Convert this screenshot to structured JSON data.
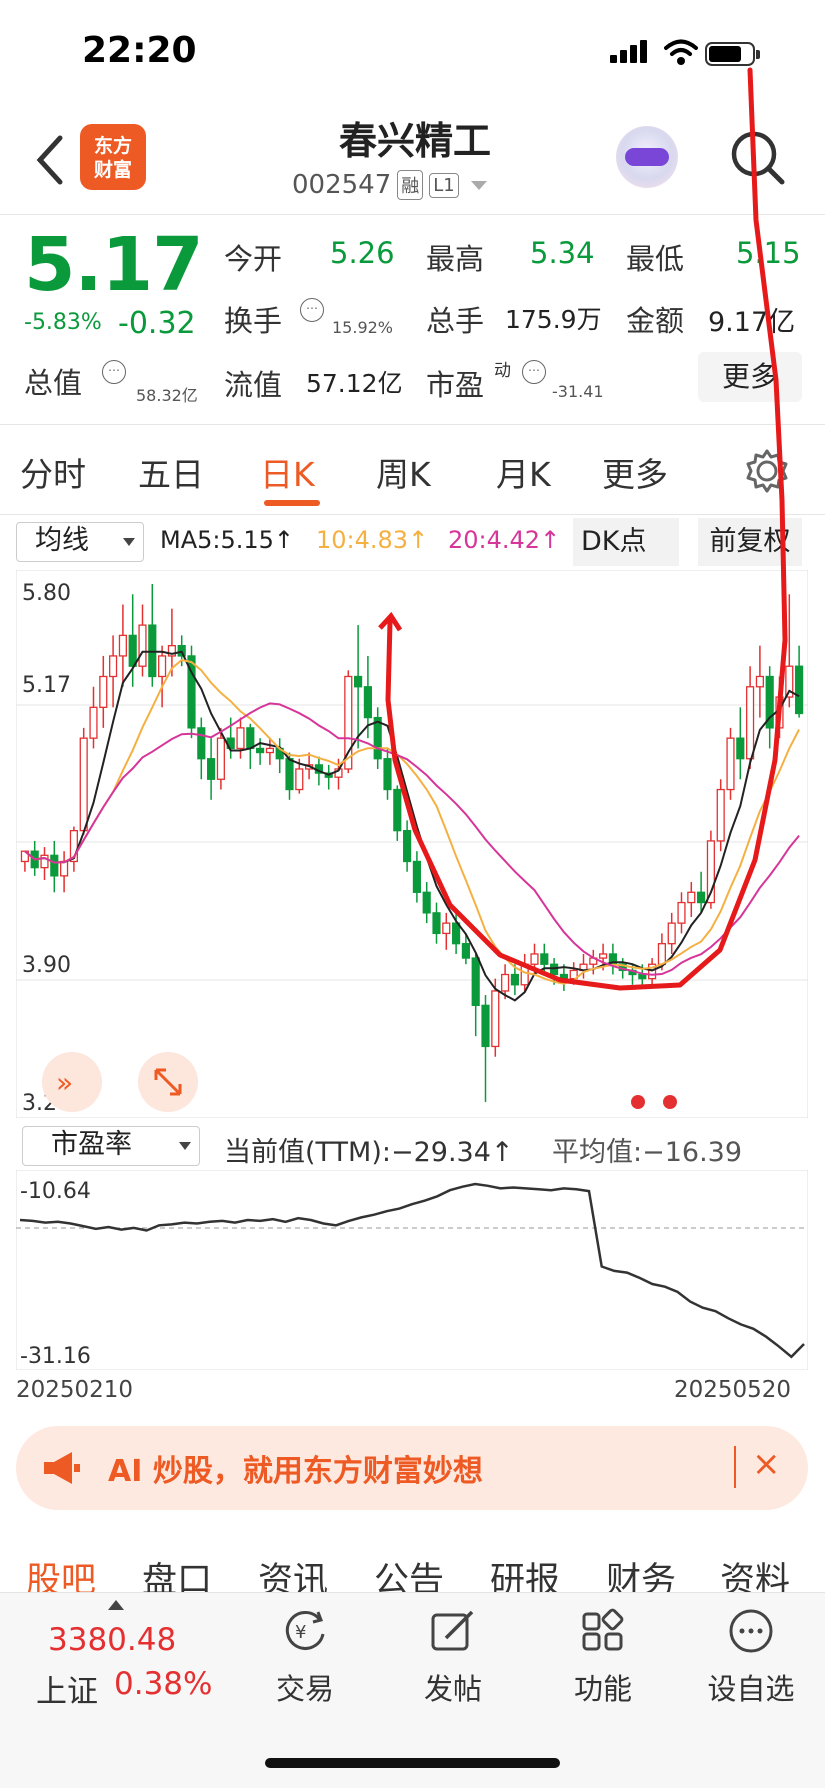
{
  "status": {
    "time": "22:20"
  },
  "header": {
    "logo_line1": "东方",
    "logo_line2": "财富",
    "title": "春兴精工",
    "code": "002547",
    "tag1": "融",
    "tag2": "L1"
  },
  "quote": {
    "price": "5.17",
    "change_pct": "-5.83%",
    "change": "-0.32",
    "open_label": "今开",
    "open": "5.26",
    "high_label": "最高",
    "high": "5.34",
    "low_label": "最低",
    "low": "5.15",
    "turnover_label": "换手",
    "turnover": "15.92%",
    "volume_label": "总手",
    "volume": "175.9万",
    "amount_label": "金额",
    "amount": "9.17亿",
    "mktcap_label": "总值",
    "mktcap": "58.32亿",
    "float_label": "流值",
    "float": "57.12亿",
    "pe_label": "市盈",
    "pe_sup": "动",
    "pe": "-31.41",
    "more": "更多"
  },
  "ktabs": [
    "分时",
    "五日",
    "日K",
    "周K",
    "月K",
    "更多"
  ],
  "indicator": {
    "select": "均线",
    "ma5": "MA5:5.15↑",
    "ma10": "10:4.83↑",
    "ma20": "20:4.42↑",
    "dk": "DK点",
    "fq": "前复权"
  },
  "colors": {
    "accent": "#ee5a24",
    "down": "#0a9a3c",
    "up": "#e43030",
    "ma10": "#f5b042",
    "ma20": "#d6359a"
  },
  "chart_data": {
    "type": "candlestick",
    "y_ticks": [
      "5.80",
      "5.17",
      "3.90",
      "3.27"
    ],
    "y_range": [
      3.27,
      5.8
    ],
    "markers": [
      "1",
      "2",
      "3",
      "4",
      "5",
      "6",
      "7",
      "8",
      "9",
      "1",
      "2",
      "3",
      "4",
      "5",
      "6",
      "8",
      "9",
      "1",
      "2",
      "3",
      "4",
      "5",
      "6",
      "7",
      "8",
      "9"
    ],
    "candles": [
      [
        4.45,
        4.5,
        4.4,
        4.5
      ],
      [
        4.5,
        4.42,
        4.38,
        4.55
      ],
      [
        4.42,
        4.48,
        4.36,
        4.52
      ],
      [
        4.48,
        4.38,
        4.3,
        4.55
      ],
      [
        4.38,
        4.45,
        4.3,
        4.5
      ],
      [
        4.45,
        4.6,
        4.4,
        4.62
      ],
      [
        4.6,
        5.05,
        4.58,
        5.1
      ],
      [
        5.05,
        5.2,
        5.0,
        5.3
      ],
      [
        5.2,
        5.35,
        5.1,
        5.45
      ],
      [
        5.35,
        5.45,
        5.2,
        5.55
      ],
      [
        5.45,
        5.55,
        5.3,
        5.7
      ],
      [
        5.55,
        5.4,
        5.3,
        5.75
      ],
      [
        5.4,
        5.6,
        5.35,
        5.7
      ],
      [
        5.6,
        5.35,
        5.3,
        5.8
      ],
      [
        5.35,
        5.45,
        5.2,
        5.5
      ],
      [
        5.45,
        5.5,
        5.35,
        5.68
      ],
      [
        5.5,
        5.45,
        5.4,
        5.55
      ],
      [
        5.45,
        5.1,
        5.05,
        5.5
      ],
      [
        5.1,
        4.95,
        4.85,
        5.15
      ],
      [
        4.95,
        4.85,
        4.75,
        5.05
      ],
      [
        4.85,
        5.05,
        4.8,
        5.1
      ],
      [
        5.05,
        5.0,
        4.95,
        5.15
      ],
      [
        5.0,
        5.1,
        4.95,
        5.15
      ],
      [
        5.1,
        5.0,
        4.9,
        5.12
      ],
      [
        5.0,
        4.98,
        4.92,
        5.05
      ],
      [
        4.98,
        5.0,
        4.92,
        5.05
      ],
      [
        5.0,
        4.95,
        4.88,
        5.05
      ],
      [
        4.95,
        4.8,
        4.75,
        4.98
      ],
      [
        4.8,
        4.9,
        4.78,
        4.95
      ],
      [
        4.9,
        4.92,
        4.85,
        4.98
      ],
      [
        4.92,
        4.88,
        4.82,
        4.96
      ],
      [
        4.88,
        4.86,
        4.8,
        4.92
      ],
      [
        4.86,
        4.9,
        4.8,
        4.95
      ],
      [
        4.9,
        5.35,
        4.88,
        5.38
      ],
      [
        5.35,
        5.3,
        5.0,
        5.6
      ],
      [
        5.3,
        5.15,
        5.05,
        5.45
      ],
      [
        5.15,
        4.95,
        4.9,
        5.2
      ],
      [
        4.95,
        4.8,
        4.75,
        5.0
      ],
      [
        4.8,
        4.6,
        4.55,
        4.82
      ],
      [
        4.6,
        4.45,
        4.4,
        4.65
      ],
      [
        4.45,
        4.3,
        4.25,
        4.5
      ],
      [
        4.3,
        4.2,
        4.15,
        4.35
      ],
      [
        4.2,
        4.1,
        4.05,
        4.25
      ],
      [
        4.1,
        4.15,
        4.02,
        4.2
      ],
      [
        4.15,
        4.05,
        4.0,
        4.22
      ],
      [
        4.05,
        3.98,
        3.95,
        4.1
      ],
      [
        3.98,
        3.75,
        3.6,
        4.0
      ],
      [
        3.75,
        3.55,
        3.28,
        3.8
      ],
      [
        3.55,
        3.82,
        3.5,
        3.88
      ],
      [
        3.82,
        3.9,
        3.78,
        3.95
      ],
      [
        3.9,
        3.85,
        3.8,
        3.95
      ],
      [
        3.85,
        3.95,
        3.82,
        4.0
      ],
      [
        3.95,
        4.0,
        3.9,
        4.05
      ],
      [
        4.0,
        3.95,
        3.9,
        4.05
      ],
      [
        3.95,
        3.9,
        3.85,
        3.98
      ],
      [
        3.9,
        3.88,
        3.82,
        3.95
      ],
      [
        3.88,
        3.92,
        3.85,
        3.96
      ],
      [
        3.92,
        3.95,
        3.88,
        4.0
      ],
      [
        3.95,
        3.98,
        3.9,
        4.02
      ],
      [
        3.98,
        4.0,
        3.92,
        4.05
      ],
      [
        4.0,
        3.95,
        3.9,
        4.05
      ],
      [
        3.95,
        3.92,
        3.88,
        3.98
      ],
      [
        3.92,
        3.9,
        3.85,
        3.95
      ],
      [
        3.9,
        3.88,
        3.84,
        3.95
      ],
      [
        3.88,
        3.95,
        3.85,
        3.98
      ],
      [
        3.95,
        4.05,
        3.92,
        4.1
      ],
      [
        4.05,
        4.15,
        4.0,
        4.2
      ],
      [
        4.15,
        4.25,
        4.1,
        4.3
      ],
      [
        4.25,
        4.3,
        4.18,
        4.35
      ],
      [
        4.3,
        4.25,
        4.2,
        4.4
      ],
      [
        4.25,
        4.55,
        4.22,
        4.6
      ],
      [
        4.55,
        4.8,
        4.5,
        4.85
      ],
      [
        4.8,
        5.05,
        4.75,
        5.1
      ],
      [
        5.05,
        4.95,
        4.85,
        5.2
      ],
      [
        4.95,
        5.3,
        4.9,
        5.4
      ],
      [
        5.3,
        5.35,
        5.15,
        5.5
      ],
      [
        5.35,
        5.1,
        5.0,
        5.4
      ],
      [
        5.1,
        5.25,
        5.05,
        5.35
      ],
      [
        5.25,
        5.4,
        5.2,
        5.75
      ],
      [
        5.4,
        5.17,
        5.15,
        5.5
      ]
    ]
  },
  "pe": {
    "select": "市盈率",
    "current": "当前值(TTM):−29.34↑",
    "avg": "平均值:−16.39",
    "y_top": "-10.64",
    "y_bottom": "-31.16",
    "date_start": "20250210",
    "date_end": "20250520",
    "series": [
      -15.2,
      -15.3,
      -15.5,
      -15.4,
      -15.6,
      -15.9,
      -16.2,
      -16.0,
      -16.3,
      -16.1,
      -16.4,
      -15.8,
      -15.7,
      -15.5,
      -15.6,
      -15.4,
      -15.3,
      -15.5,
      -15.2,
      -15.3,
      -15.1,
      -15.4,
      -15.0,
      -15.2,
      -15.6,
      -15.8,
      -15.3,
      -14.9,
      -14.6,
      -14.2,
      -13.9,
      -13.4,
      -13.0,
      -12.5,
      -11.8,
      -11.4,
      -11.1,
      -11.3,
      -11.6,
      -11.5,
      -11.6,
      -11.7,
      -11.8,
      -11.6,
      -11.7,
      -11.9,
      -20.5,
      -21.0,
      -21.2,
      -21.8,
      -22.5,
      -22.8,
      -23.4,
      -24.5,
      -25.2,
      -25.6,
      -26.4,
      -27.1,
      -27.6,
      -28.5,
      -29.6,
      -30.8,
      -29.34
    ]
  },
  "ad": {
    "text": "AI 炒股，就用东方财富妙想",
    "close": "×"
  },
  "section_tabs": [
    "股吧",
    "盘口",
    "资讯",
    "公告",
    "研报",
    "财务",
    "资料"
  ],
  "bottom": {
    "index_value": "3380.48",
    "index_name": "上证",
    "index_pct": "0.38%",
    "nav": [
      "交易",
      "发帖",
      "功能",
      "设自选"
    ]
  }
}
